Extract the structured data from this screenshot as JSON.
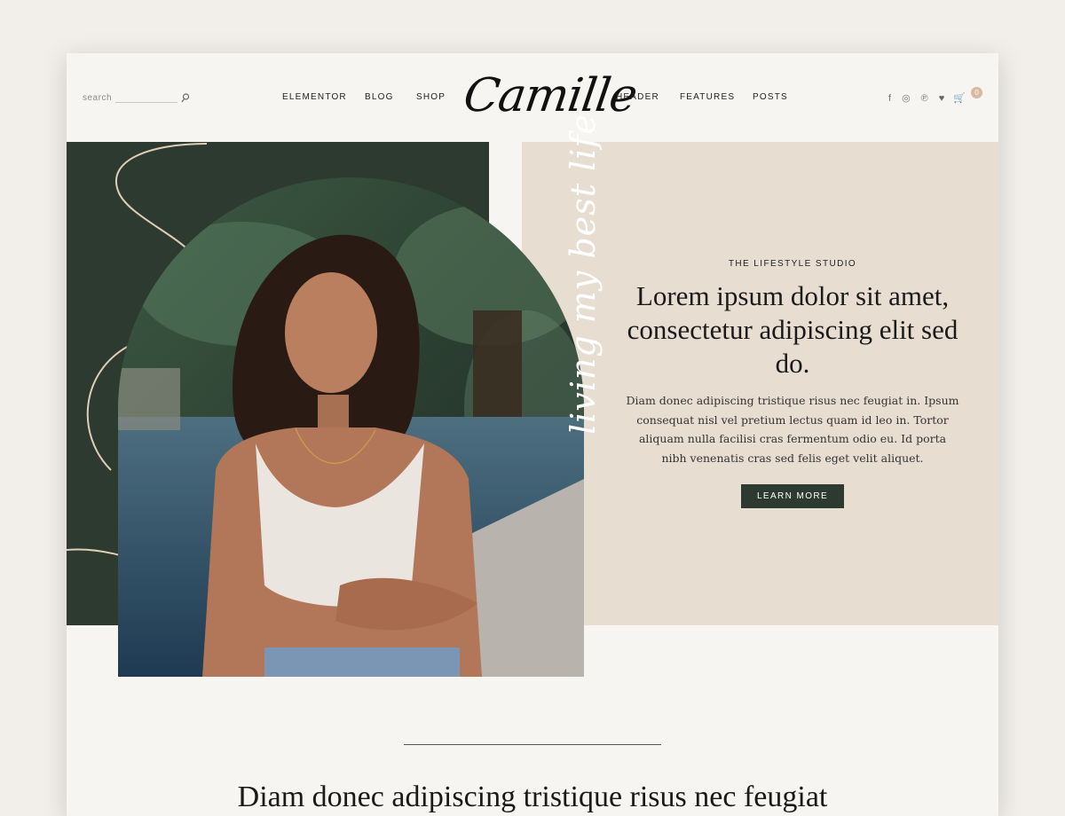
{
  "search": {
    "label": "search"
  },
  "nav": {
    "left": [
      "ELEMENTOR",
      "BLOG",
      "SHOP"
    ],
    "right": [
      "HEADER",
      "FEATURES",
      "POSTS"
    ]
  },
  "logo": "Camille",
  "social": {
    "icons": [
      "facebook-icon",
      "instagram-icon",
      "pinterest-icon",
      "heart-icon",
      "cart-icon"
    ],
    "facebook": "f",
    "instagram": "◎",
    "pinterest": "℗",
    "heart": "♥",
    "cart": "🛒",
    "cart_count": "0"
  },
  "hero": {
    "script": "living my best life",
    "eyebrow": "THE LIFESTYLE STUDIO",
    "headline": "Lorem ipsum dolor sit amet, consectetur adipiscing elit sed do.",
    "body": "Diam donec adipiscing tristique risus nec feugiat in. Ipsum consequat nisl vel pretium lectus quam id leo in. Tortor aliquam nulla facilisi cras fermentum odio eu. Id porta nibh venenatis cras sed felis eget velit aliquet.",
    "cta": "LEARN MORE"
  },
  "bottom": {
    "heading": "Diam donec adipiscing tristique risus nec feugiat"
  },
  "colors": {
    "green": "#2c3a2f",
    "beige": "#e8ddd1",
    "accent": "#d7b8a3",
    "background": "#f7f5f1"
  }
}
